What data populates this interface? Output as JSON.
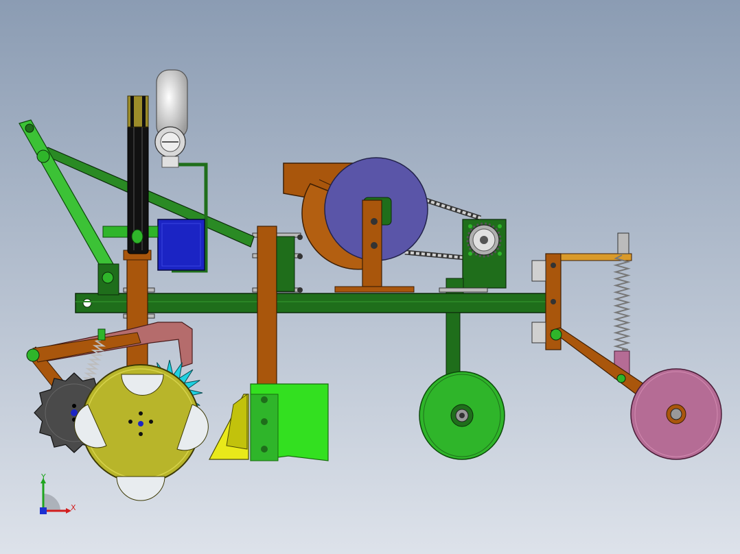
{
  "view": {
    "background_top": "#8b9cb3",
    "background_bottom": "#dde2ea"
  },
  "colors": {
    "frame_green": "#1f6e1b",
    "bright_green": "#2fb52a",
    "orange": "#a9560c",
    "orange_dark": "#6e3405",
    "blue_disc": "#5a55a8",
    "blue_box": "#1b24c4",
    "yellow_wheel": "#b8b52a",
    "pink_wheel": "#b56c95",
    "gray_wheel": "#4a4a4a",
    "cyan_gear": "#1fd0e0",
    "lime": "#33e020",
    "spring": "#c9c9c9"
  },
  "components": {
    "motor": "motor-pulley-icon",
    "belt": "v-belt-icon",
    "gear_box": "gear-box-icon",
    "seed_hopper": "seed-hopper-icon",
    "seed_disc": "seed-disc-icon",
    "chain": "roller-chain-icon",
    "sprocket": "sprocket-icon",
    "opener": "furrow-opener-icon",
    "depth_wheel": "depth-wheel-icon",
    "press_wheel": "press-wheel-icon",
    "drive_wheel": "drive-wheel-icon",
    "star_wheel": "star-wheel-icon",
    "spring": "compression-spring-icon"
  },
  "triad": {
    "x_label": "X",
    "y_label": "Y",
    "x_color": "#d21e1e",
    "y_color": "#1fa51f",
    "z_color": "#1c2fd2"
  }
}
